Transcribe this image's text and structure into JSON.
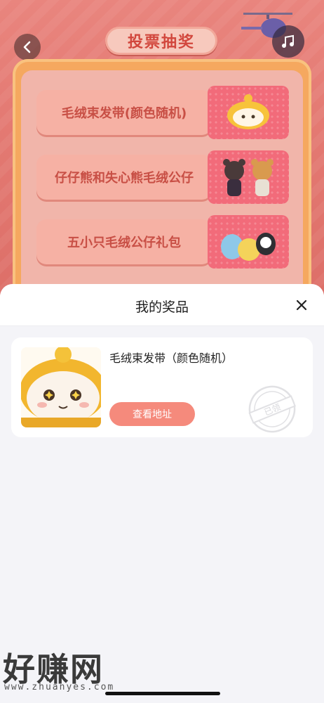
{
  "background": {
    "title": "投票抽奖",
    "prizes": [
      {
        "label": "毛绒束发带(颜色随机)",
        "image": "plush-headband"
      },
      {
        "label": "仔仔熊和失心熊毛绒公仔",
        "image": "bear-plush-pair"
      },
      {
        "label": "五小只毛绒公仔礼包",
        "image": "plush-bundle"
      }
    ]
  },
  "sheet": {
    "title": "我的奖品",
    "close_icon": "close-icon",
    "card": {
      "name": "毛绒束发带（颜色随机）",
      "button_label": "查看地址",
      "stamp_text": "已领"
    }
  },
  "watermark": {
    "big": "好赚网",
    "small": "www.zhuanyes.com"
  },
  "colors": {
    "accent": "#f58a7c",
    "title_red": "#d2473d",
    "sheet_bg": "#f4f4f8"
  }
}
